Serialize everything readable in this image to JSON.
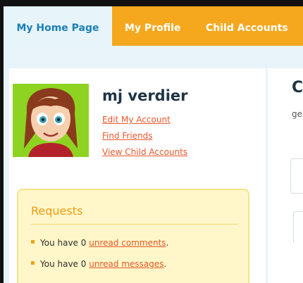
{
  "tabs": [
    {
      "label": "My Home Page",
      "active": true
    },
    {
      "label": "My Profile",
      "active": false
    },
    {
      "label": "Child Accounts",
      "active": false
    }
  ],
  "profile": {
    "username": "mj verdier",
    "links": [
      "Edit My Account",
      "Find Friends",
      "View Child Accounts"
    ]
  },
  "requests": {
    "title": "Requests",
    "rows": [
      {
        "prefix": "You have 0 ",
        "link": "unread comments",
        "suffix": "."
      },
      {
        "prefix": "You have 0 ",
        "link": "unread messages",
        "suffix": "."
      }
    ]
  },
  "right_panel": {
    "heading": "C",
    "subtext": "ge"
  },
  "colors": {
    "tab_bar": "#f5a81e",
    "active_tab_text": "#1b7fb4",
    "link": "#e8572a",
    "requests_title": "#f29b14",
    "avatar_bg": "#8ed321"
  }
}
